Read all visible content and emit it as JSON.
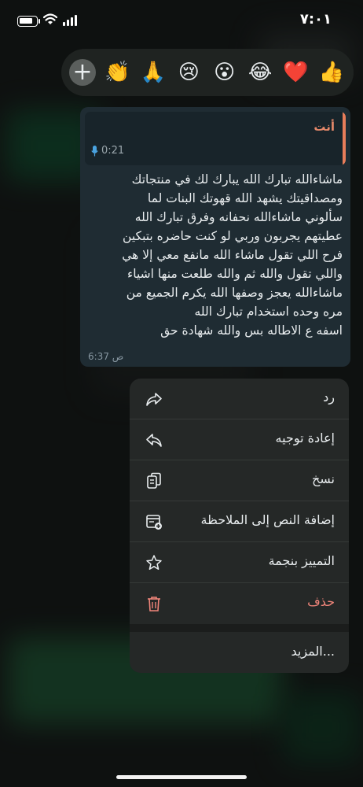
{
  "status_bar": {
    "time": "٧:٠١"
  },
  "reactions": {
    "add_label": "+",
    "emojis": [
      "👍",
      "❤️",
      "😂",
      "😮",
      "😢",
      "🙏",
      "👏"
    ]
  },
  "message": {
    "quote_sender": "أنت",
    "quote_duration": "0:21",
    "text": "ماشاءالله تبارك الله يبارك لك في منتجاتك\nومصداقيتك يشهد الله قهوتك البنات لما\nسألوني ماشاءالله نحفانه وفرق تبارك الله\nعطيتهم يجربون وربي لو كنت حاضره بتبكين\nفرح اللي تقول ماشاء الله مانفع معي إلا هي\nواللي تقول والله ثم والله طلعت منها اشياء\nماشاءالله يعجز وصفها الله يكرم الجميع من\nمره وحده استخدام تبارك الله\nاسفه ع الاطاله بس والله شهادة حق",
    "time": "6:37 ص"
  },
  "menu": {
    "items": [
      {
        "label": "رد",
        "icon": "reply-icon"
      },
      {
        "label": "إعادة توجيه",
        "icon": "forward-icon"
      },
      {
        "label": "نسخ",
        "icon": "copy-icon"
      },
      {
        "label": "إضافة النص إلى الملاحظة",
        "icon": "add-note-icon"
      },
      {
        "label": "التمييز بنجمة",
        "icon": "star-icon"
      },
      {
        "label": "حذف",
        "icon": "trash-icon"
      }
    ],
    "more_label": "المزيد..."
  },
  "colors": {
    "danger": "#f0857a",
    "quote_accent": "#e87d5a",
    "bubble": "#1f2c33"
  }
}
